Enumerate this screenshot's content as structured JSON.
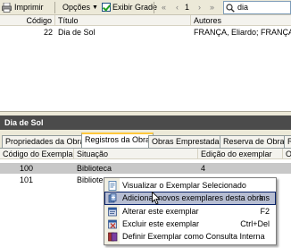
{
  "toolbar": {
    "print_label": "Imprimir",
    "options_label": "Opções",
    "show_grid_label": "Exibir Grade",
    "page_number": "1",
    "search_value": "dia"
  },
  "results": {
    "columns": [
      "Código",
      "Título",
      "Autores"
    ],
    "rows": [
      {
        "codigo": "22",
        "titulo": "Dia de Sol",
        "autores": "FRANÇA, Eliardo; FRANÇA, Ma"
      }
    ]
  },
  "panel": {
    "title": "Dia de Sol",
    "tabs": [
      "Propriedades da Obra",
      "Registros da Obra",
      "Obras Emprestadas",
      "Reserva de Obras",
      "Re"
    ]
  },
  "copies": {
    "columns": [
      "Código do Exemplar",
      "Situação",
      "Edição do exemplar",
      "Ol"
    ],
    "rows": [
      {
        "codigo": "100",
        "situacao": "Biblioteca",
        "edicao": "4"
      },
      {
        "codigo": "101",
        "situacao": "Bibliote",
        "edicao": ""
      }
    ]
  },
  "context_menu": {
    "items": [
      {
        "label": "Visualizar o Exemplar Selecionado",
        "shortcut": "",
        "icon": "view-icon"
      },
      {
        "label": "Adicionar novos exemplares desta obra",
        "shortcut": "Ins",
        "icon": "add-copies-icon"
      },
      {
        "label": "Alterar este exemplar",
        "shortcut": "F2",
        "icon": "edit-icon"
      },
      {
        "label": "Excluir este exemplar",
        "shortcut": "Ctrl+Del",
        "icon": "delete-icon"
      },
      {
        "label": "Definir Exemplar como Consulta Interna",
        "shortcut": "",
        "icon": "internal-consult-icon"
      }
    ]
  },
  "colors": {
    "panel_title_bg": "#4b4b4b",
    "selected_row": "#c8c8c8",
    "menu_highlight": "#b6bdd2",
    "active_tab_accent": "#ffc83c"
  }
}
